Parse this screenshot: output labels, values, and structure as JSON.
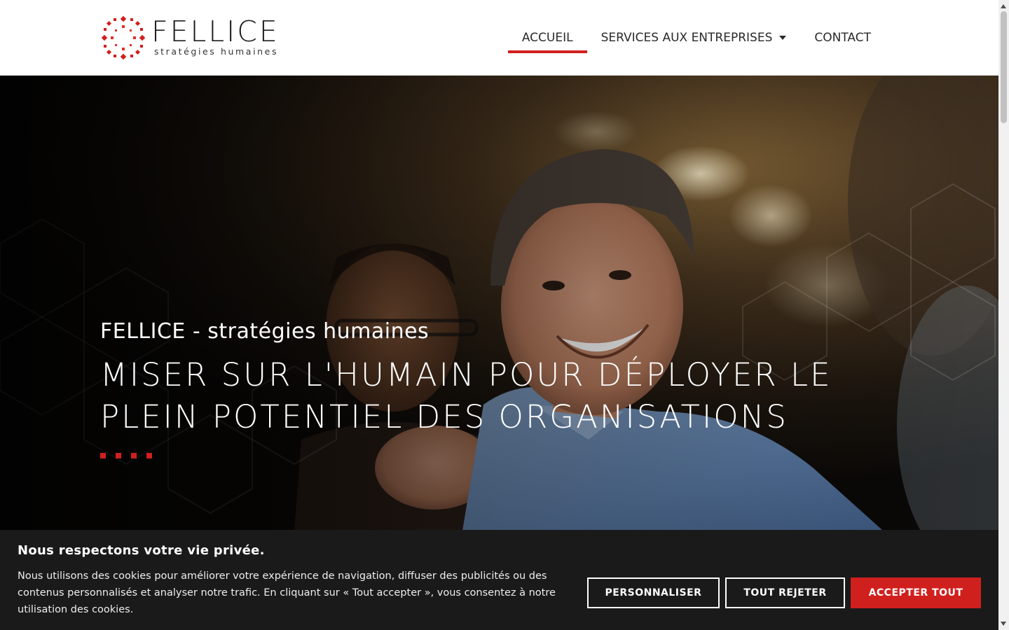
{
  "brand": {
    "name": "FELLICE",
    "tagline": "stratégies humaines",
    "accent_color": "#d0201e"
  },
  "nav": {
    "items": [
      {
        "label": "ACCUEIL",
        "active": true
      },
      {
        "label": "SERVICES AUX ENTREPRISES",
        "has_dropdown": true,
        "icon": "caret-down-icon"
      },
      {
        "label": "CONTACT"
      }
    ]
  },
  "hero": {
    "subtitle": "FELLICE - stratégies humaines",
    "title": "MISER SUR L'HUMAIN POUR DÉPLOYER LE PLEIN POTENTIEL DES ORGANISATIONS",
    "image": "smiling man in blue shirt with colleague, hexagon overlay"
  },
  "cookie": {
    "title": "Nous respectons votre vie privée.",
    "text": "Nous utilisons des cookies pour améliorer votre expérience de navigation, diffuser des publicités ou des contenus personnalisés et analyser notre trafic. En cliquant sur « Tout accepter », vous consentez à notre utilisation des cookies.",
    "buttons": {
      "customize": "PERSONNALISER",
      "reject": "TOUT REJETER",
      "accept": "ACCEPTER TOUT"
    }
  }
}
